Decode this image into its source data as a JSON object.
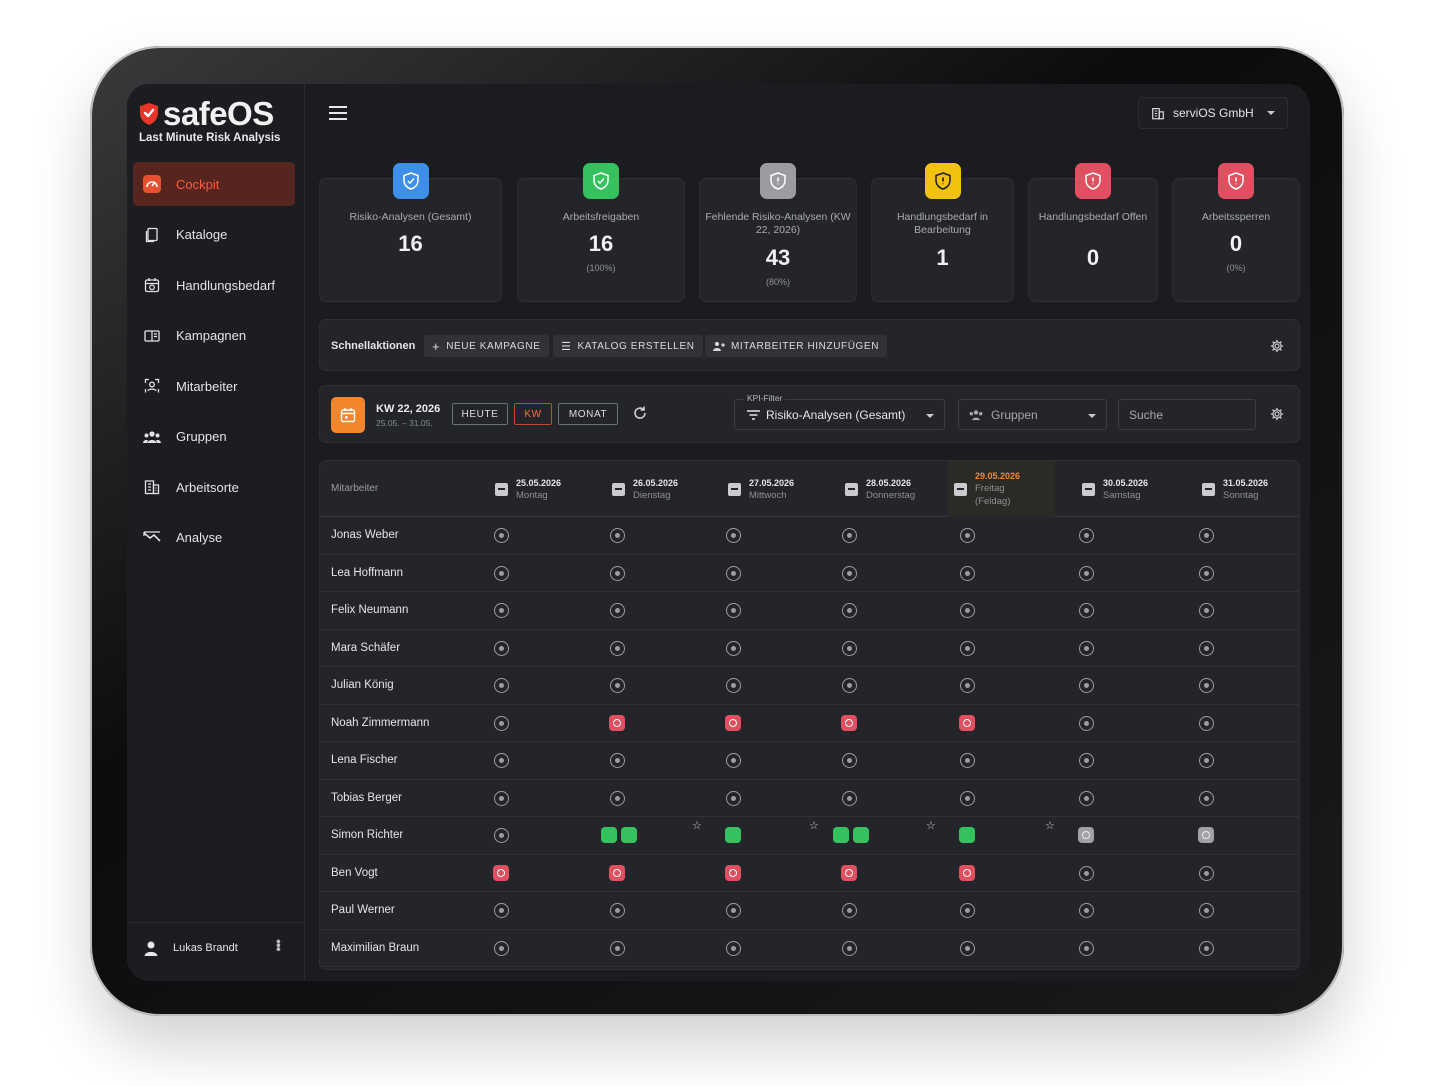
{
  "brand": {
    "name": "safeOS",
    "tagline": "Last Minute Risk Analysis"
  },
  "sidebar": {
    "items": [
      {
        "label": "Cockpit",
        "icon": "gauge-icon",
        "active": true
      },
      {
        "label": "Kataloge",
        "icon": "documents-icon"
      },
      {
        "label": "Handlungsbedarf",
        "icon": "calendar-check-icon"
      },
      {
        "label": "Kampagnen",
        "icon": "book-open-icon"
      },
      {
        "label": "Mitarbeiter",
        "icon": "person-badge-icon"
      },
      {
        "label": "Gruppen",
        "icon": "group-icon"
      },
      {
        "label": "Arbeitsorte",
        "icon": "building-icon"
      },
      {
        "label": "Analyse",
        "icon": "chart-analysis-icon"
      }
    ]
  },
  "user": {
    "name": "Lukas Brandt"
  },
  "header": {
    "company": "serviOS GmbH"
  },
  "kpis": [
    {
      "label": "Risiko-Analysen (Gesamt)",
      "value": "16",
      "sub": "",
      "color": "#3d8fe8"
    },
    {
      "label": "Arbeitsfreigaben",
      "value": "16",
      "sub": "(100%)",
      "color": "#35c25e"
    },
    {
      "label": "Fehlende Risiko-Analysen (KW 22, 2026)",
      "value": "43",
      "sub": "(80%)",
      "color": "#9a9ca2"
    },
    {
      "label": "Handlungsbedarf in Bearbeitung",
      "value": "1",
      "sub": "",
      "color": "#f2c20f"
    },
    {
      "label": "Handlungsbedarf Offen",
      "value": "0",
      "sub": "",
      "color": "#e05060"
    },
    {
      "label": "Arbeitssperren",
      "value": "0",
      "sub": "(0%)",
      "color": "#e05060"
    }
  ],
  "quick": {
    "title": "Schnellaktionen",
    "actions": [
      "NEUE KAMPAGNE",
      "KATALOG ERSTELLEN",
      "MITARBEITER HINZUFÜGEN"
    ]
  },
  "toolbar": {
    "week": "KW 22, 2026",
    "range": "25.05. – 31.05.",
    "buttons": [
      "HEUTE",
      "KW",
      "MONAT"
    ],
    "active_button": "KW",
    "kpi_filter_legend": "KPI-Filter",
    "kpi_filter_value": "Risiko-Analysen (Gesamt)",
    "groups_placeholder": "Gruppen",
    "search_placeholder": "Suche"
  },
  "table": {
    "employee_header": "Mitarbeiter",
    "days": [
      {
        "date": "25.05.2026",
        "weekday": "Montag"
      },
      {
        "date": "26.05.2026",
        "weekday": "Dienstag"
      },
      {
        "date": "27.05.2026",
        "weekday": "Mittwoch"
      },
      {
        "date": "28.05.2026",
        "weekday": "Donnerstag"
      },
      {
        "date": "29.05.2026",
        "weekday": "Freitag",
        "note": "(Feldag)",
        "holiday": true
      },
      {
        "date": "30.05.2026",
        "weekday": "Samstag"
      },
      {
        "date": "31.05.2026",
        "weekday": "Sonntag"
      }
    ],
    "rows": [
      {
        "name": "Jonas Weber",
        "cells": [
          "n",
          "n",
          "n",
          "n",
          "n",
          "n",
          "n"
        ]
      },
      {
        "name": "Lea Hoffmann",
        "cells": [
          "n",
          "n",
          "n",
          "n",
          "n",
          "n",
          "n"
        ]
      },
      {
        "name": "Felix Neumann",
        "cells": [
          "n",
          "n",
          "n",
          "n",
          "n",
          "n",
          "n"
        ]
      },
      {
        "name": "Mara Schäfer",
        "cells": [
          "n",
          "n",
          "n",
          "n",
          "n",
          "n",
          "n"
        ]
      },
      {
        "name": "Julian König",
        "cells": [
          "n",
          "n",
          "n",
          "n",
          "n",
          "n",
          "n"
        ]
      },
      {
        "name": "Noah Zimmermann",
        "cells": [
          "n",
          "r",
          "r",
          "r",
          "r",
          "n",
          "n"
        ]
      },
      {
        "name": "Lena Fischer",
        "cells": [
          "n",
          "n",
          "n",
          "n",
          "n",
          "n",
          "n"
        ]
      },
      {
        "name": "Tobias Berger",
        "cells": [
          "n",
          "n",
          "n",
          "n",
          "n",
          "n",
          "n"
        ]
      },
      {
        "name": "Simon Richter",
        "cells": [
          "n",
          "gg",
          "g",
          "gg",
          "g",
          "x",
          "x"
        ],
        "stars": [
          1,
          2,
          3,
          4
        ]
      },
      {
        "name": "Ben Vogt",
        "cells": [
          "r",
          "r",
          "r",
          "r",
          "r",
          "n",
          "n"
        ]
      },
      {
        "name": "Paul Werner",
        "cells": [
          "n",
          "n",
          "n",
          "n",
          "n",
          "n",
          "n"
        ]
      },
      {
        "name": "Maximilian Braun",
        "cells": [
          "n",
          "n",
          "n",
          "n",
          "n",
          "n",
          "n"
        ]
      }
    ]
  }
}
